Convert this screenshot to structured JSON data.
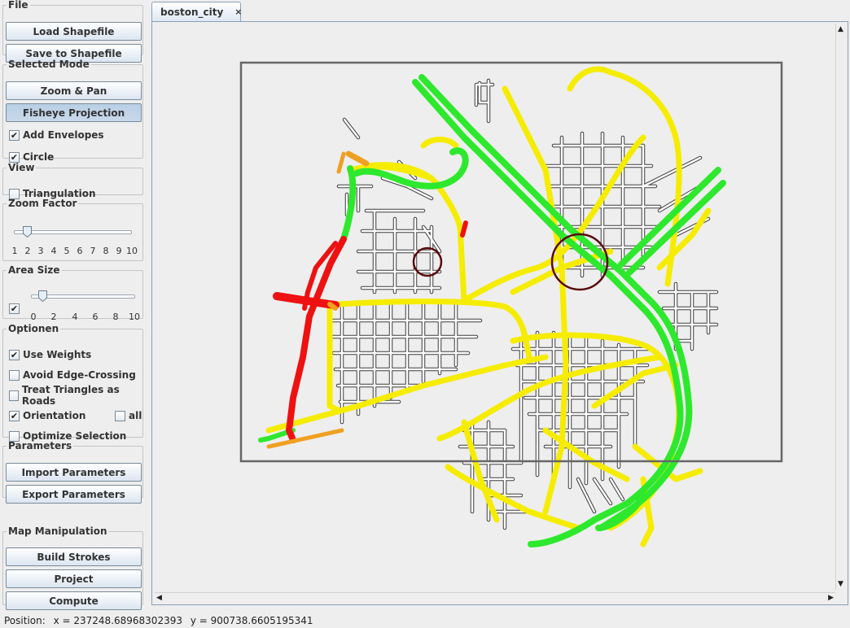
{
  "file_group": {
    "legend": "File",
    "load_label": "Load Shapefile",
    "save_label": "Save to Shapefile"
  },
  "mode_group": {
    "legend": "Selected Mode",
    "zoom_pan_label": "Zoom & Pan",
    "fisheye_label": "Fisheye Projection",
    "add_envelopes_label": "Add Envelopes",
    "add_envelopes_checked": true,
    "circle_label": "Circle",
    "circle_checked": true
  },
  "view_group": {
    "legend": "View",
    "triangulation_label": "Triangulation",
    "triangulation_checked": false
  },
  "zoom_group": {
    "legend": "Zoom Factor",
    "value": 2,
    "ticks": [
      "1",
      "2",
      "3",
      "4",
      "5",
      "6",
      "7",
      "8",
      "9",
      "10"
    ]
  },
  "area_group": {
    "legend": "Area Size",
    "enabled": true,
    "value": 1,
    "ticks": [
      "0",
      "2",
      "4",
      "6",
      "8",
      "10"
    ]
  },
  "options_group": {
    "legend": "Optionen",
    "use_weights_label": "Use Weights",
    "use_weights_checked": true,
    "avoid_crossing_label": "Avoid Edge-Crossing",
    "avoid_crossing_checked": false,
    "treat_triangles_label": "Treat Triangles as Roads",
    "treat_triangles_checked": false,
    "orientation_label": "Orientation",
    "orientation_checked": true,
    "all_label": "all",
    "all_checked": false,
    "optimize_label": "Optimize Selection",
    "optimize_checked": false
  },
  "params_group": {
    "legend": "Parameters",
    "import_label": "Import Parameters",
    "export_label": "Export Parameters"
  },
  "manip_group": {
    "legend": "Map Manipulation",
    "build_label": "Build Strokes",
    "project_label": "Project",
    "compute_label": "Compute"
  },
  "tab": {
    "label": "boston_city",
    "close_glyph": "×"
  },
  "status": {
    "label": "Position:",
    "x": "x = 237248.68968302393",
    "y": "y = 900738.6605195341"
  },
  "colors": {
    "road_minor": "#ffffff",
    "road_major": "#f5ec00",
    "road_highway": "#2ee82e",
    "road_red": "#ee1111",
    "road_orange": "#f0a020",
    "circle": "#5a0a0a",
    "envelope": "#666666"
  }
}
